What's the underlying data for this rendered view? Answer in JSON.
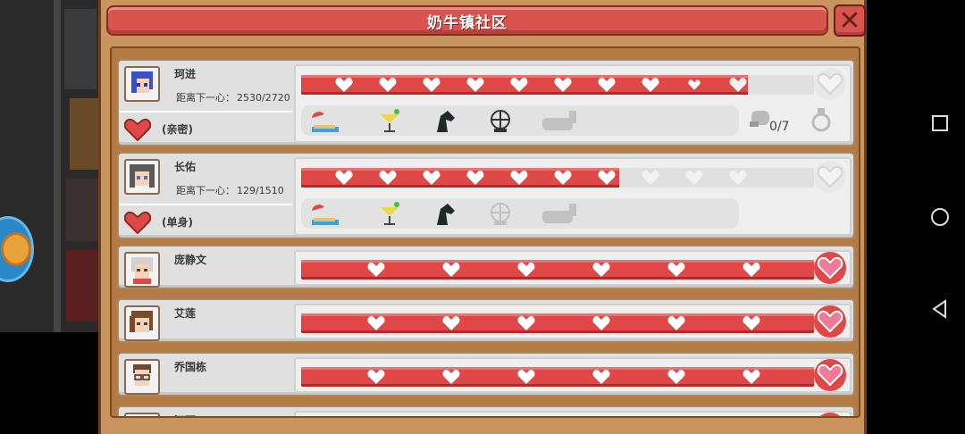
{
  "header": {
    "title": "奶牛镇社区",
    "close_icon": "close-icon"
  },
  "colors": {
    "accent": "#d9534f",
    "bar_fill": "#e04848",
    "panel": "#c9945d",
    "row_bg": "#e0e0e0"
  },
  "residents": [
    {
      "name": "珂进",
      "next_label": "距离下一心：",
      "progress": "2530/2720",
      "status": "(亲密)",
      "hearts_filled": 9,
      "hearts_total": 11,
      "partial_heart": true,
      "gifts": [
        {
          "icon": "umbrella-beach-icon",
          "unlocked": true
        },
        {
          "icon": "cocktail-icon",
          "unlocked": true
        },
        {
          "icon": "horse-head-icon",
          "unlocked": true
        },
        {
          "icon": "ferris-wheel-icon",
          "unlocked": true
        },
        {
          "icon": "alpaca-icon",
          "unlocked": false
        }
      ],
      "collection": "0/7"
    },
    {
      "name": "长佑",
      "next_label": "距离下一心：",
      "progress": "129/1510",
      "status": "(单身)",
      "hearts_filled": 7,
      "hearts_total": 11,
      "partial_heart": false,
      "gifts": [
        {
          "icon": "umbrella-beach-icon",
          "unlocked": true
        },
        {
          "icon": "cocktail-icon",
          "unlocked": true
        },
        {
          "icon": "horse-head-icon",
          "unlocked": true
        },
        {
          "icon": "ferris-wheel-icon",
          "unlocked": false
        },
        {
          "icon": "alpaca-icon",
          "unlocked": false
        }
      ]
    },
    {
      "name": "庞静文",
      "hearts_filled": 6,
      "hearts_total": 6,
      "maxed": true
    },
    {
      "name": "艾莲",
      "hearts_filled": 6,
      "hearts_total": 6,
      "maxed": true
    },
    {
      "name": "乔国栋",
      "hearts_filled": 6,
      "hearts_total": 6,
      "maxed": true
    },
    {
      "name": "江珂",
      "hearts_filled": 6,
      "hearts_total": 6,
      "maxed": true
    }
  ],
  "nav": {
    "recents": "square-icon",
    "home": "circle-icon",
    "back": "triangle-back-icon"
  }
}
